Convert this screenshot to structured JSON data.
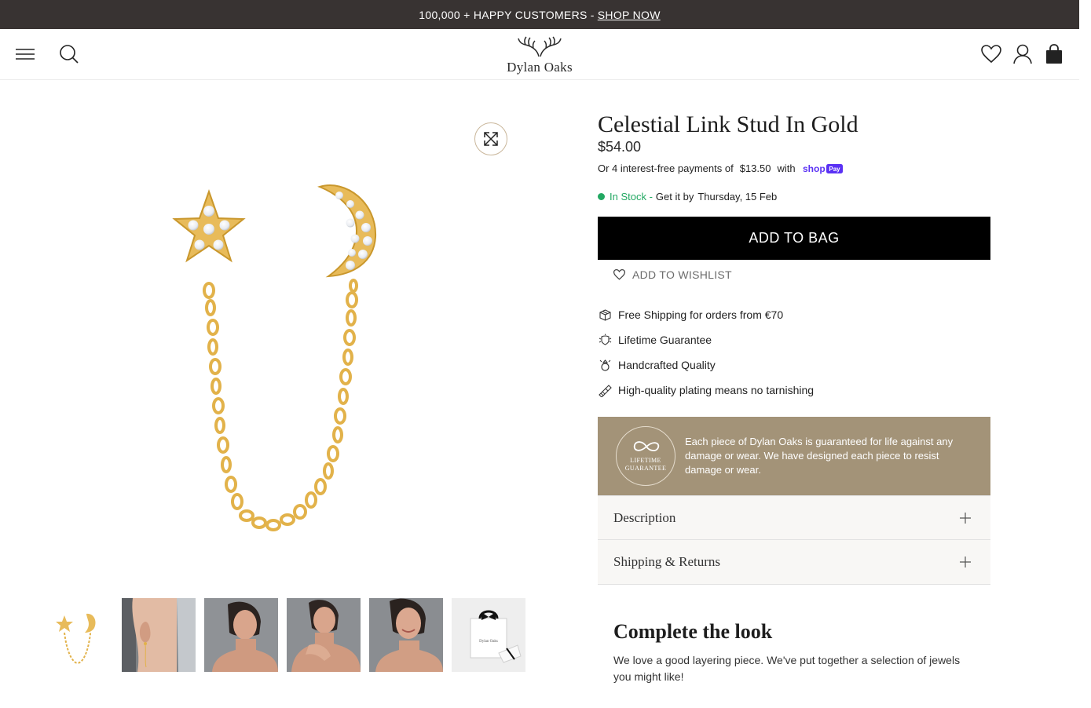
{
  "announcement": {
    "text": "100,000 + HAPPY CUSTOMERS -",
    "link": "SHOP NOW"
  },
  "header": {
    "logo_text": "Dylan Oaks",
    "icons": [
      "menu-icon",
      "search-icon",
      "heart-icon",
      "account-icon",
      "bag-icon"
    ]
  },
  "product": {
    "title": "Celestial Link Stud In Gold",
    "price": "$54.00",
    "installments": {
      "prefix": "Or 4 interest-free payments of",
      "amount": "$13.50",
      "with": "with",
      "provider": "shop Pay"
    },
    "stock": {
      "status": "In Stock -",
      "label": "Get it by",
      "date": "Thursday, 15 Feb"
    },
    "add_to_bag": "ADD TO BAG",
    "add_to_wishlist": "ADD TO WISHLIST",
    "features": [
      {
        "icon": "box-icon",
        "text": "Free Shipping for orders from €70"
      },
      {
        "icon": "shield-icon",
        "text": "Lifetime Guarantee"
      },
      {
        "icon": "ring-icon",
        "text": "Handcrafted Quality"
      },
      {
        "icon": "plating-icon",
        "text": "High-quality plating means no tarnishing"
      }
    ],
    "guarantee": {
      "badge_line1": "LIFETIME",
      "badge_line2": "GUARANTEE",
      "text": "Each piece of Dylan Oaks is guaranteed for life against any damage or wear. We have designed each piece to resist damage or wear."
    },
    "accordions": [
      "Description",
      "Shipping & Returns"
    ]
  },
  "gallery": {
    "thumbnails": [
      "product-thumb",
      "ear-model-thumb",
      "model-portrait-thumb",
      "model-hand-thumb",
      "model-smile-thumb",
      "gift-bag-thumb"
    ]
  },
  "complete_look": {
    "title": "Complete the look",
    "text": "We love a good layering piece. We've put together a selection of jewels you might like!"
  },
  "colors": {
    "announcement_bg": "#383332",
    "gold": "#e2b24a",
    "in_stock": "#22a862",
    "guarantee_bg": "#a39378",
    "shop_pay": "#5a31f4"
  }
}
